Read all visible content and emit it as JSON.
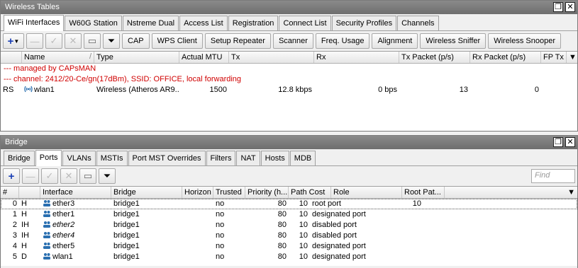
{
  "top": {
    "title": "Wireless Tables",
    "tabs": [
      "WiFi Interfaces",
      "W60G Station",
      "Nstreme Dual",
      "Access List",
      "Registration",
      "Connect List",
      "Security Profiles",
      "Channels"
    ],
    "buttons": [
      "CAP",
      "WPS Client",
      "Setup Repeater",
      "Scanner",
      "Freq. Usage",
      "Alignment",
      "Wireless Sniffer",
      "Wireless Snooper"
    ],
    "columns": [
      "Name",
      "Type",
      "Actual MTU",
      "Tx",
      "Rx",
      "Tx Packet (p/s)",
      "Rx Packet (p/s)",
      "FP Tx"
    ],
    "comments": [
      "--- managed by CAPsMAN",
      "--- channel: 2412/20-Ce/gn(17dBm), SSID: OFFICE, local forwarding"
    ],
    "row": {
      "flags": "RS",
      "name": "wlan1",
      "type": "Wireless (Atheros AR9...",
      "mtu": "1500",
      "tx": "12.8 kbps",
      "rx": "0 bps",
      "txp": "13",
      "rxp": "0"
    }
  },
  "bridge": {
    "title": "Bridge",
    "tabs": [
      "Bridge",
      "Ports",
      "VLANs",
      "MSTIs",
      "Port MST Overrides",
      "Filters",
      "NAT",
      "Hosts",
      "MDB"
    ],
    "find_placeholder": "Find",
    "columns": [
      "#",
      "Interface",
      "Bridge",
      "Horizon",
      "Trusted",
      "Priority (h...",
      "Path Cost",
      "Role",
      "Root Pat..."
    ],
    "rows": [
      {
        "num": "0",
        "flag": "H",
        "iface": "ether3",
        "bridge": "bridge1",
        "trusted": "no",
        "priority": "80",
        "cost": "10",
        "role": "root port",
        "rootpath": "10",
        "italic": false
      },
      {
        "num": "1",
        "flag": "H",
        "iface": "ether1",
        "bridge": "bridge1",
        "trusted": "no",
        "priority": "80",
        "cost": "10",
        "role": "designated port",
        "rootpath": "",
        "italic": false
      },
      {
        "num": "2",
        "flag": "IH",
        "iface": "ether2",
        "bridge": "bridge1",
        "trusted": "no",
        "priority": "80",
        "cost": "10",
        "role": "disabled port",
        "rootpath": "",
        "italic": true
      },
      {
        "num": "3",
        "flag": "IH",
        "iface": "ether4",
        "bridge": "bridge1",
        "trusted": "no",
        "priority": "80",
        "cost": "10",
        "role": "disabled port",
        "rootpath": "",
        "italic": true
      },
      {
        "num": "4",
        "flag": "H",
        "iface": "ether5",
        "bridge": "bridge1",
        "trusted": "no",
        "priority": "80",
        "cost": "10",
        "role": "designated port",
        "rootpath": "",
        "italic": false
      },
      {
        "num": "5",
        "flag": "D",
        "iface": "wlan1",
        "bridge": "bridge1",
        "trusted": "no",
        "priority": "80",
        "cost": "10",
        "role": "designated port",
        "rootpath": "",
        "italic": false
      }
    ]
  },
  "colors": {
    "comment": "#d00000",
    "add": "#1a3fb5",
    "iface_icon": "#2a6fb0"
  }
}
